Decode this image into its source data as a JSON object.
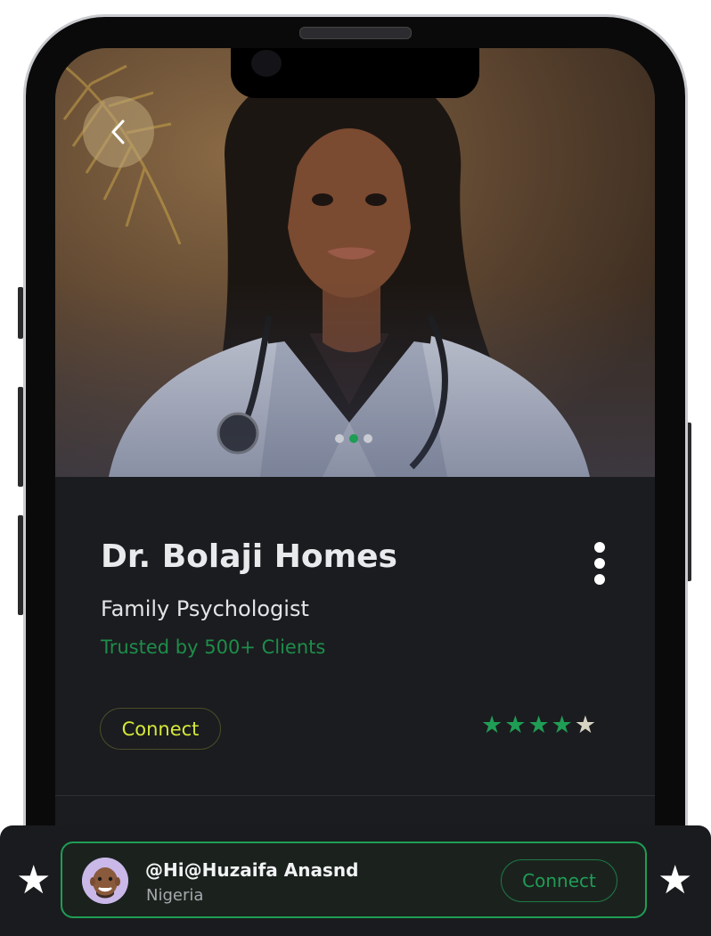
{
  "profile": {
    "name": "Dr. Bolaji Homes",
    "title": "Family Psychologist",
    "trust_line": "Trusted by 500+ Clients",
    "connect_label": "Connect",
    "rating": 4,
    "rating_max": 5,
    "carousel": {
      "count": 3,
      "active_index": 1
    }
  },
  "stars": {
    "filled": "★",
    "empty": "★"
  },
  "user_card": {
    "handle": "@Hi@Huzaifa Anasnd",
    "country": "Nigeria",
    "connect_label": "Connect"
  },
  "colors": {
    "accent_green": "#1f9d55",
    "connect_yellow": "#d6e83a",
    "background": "#1b1c1f"
  },
  "icons": {
    "back": "chevron-left-icon",
    "menu": "more-vertical-icon",
    "star": "star-icon",
    "avatar": "memoji-avatar"
  }
}
